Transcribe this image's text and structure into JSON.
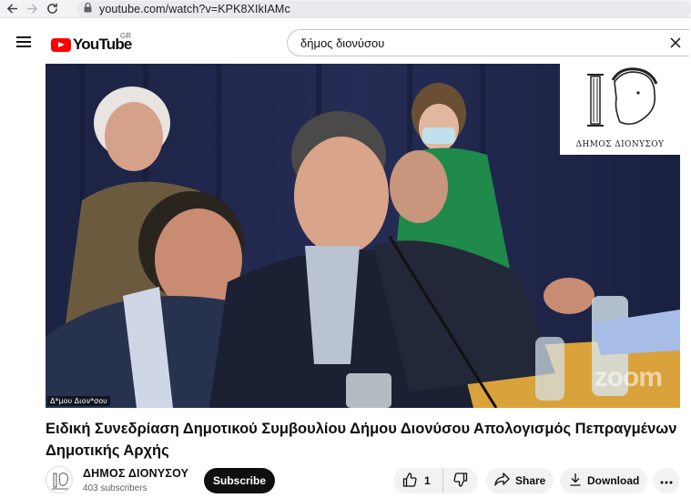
{
  "browser": {
    "url": "youtube.com/watch?v=KPK8XIkIAMc"
  },
  "header": {
    "logo_text": "YouTube",
    "region": "GR",
    "search_value": "δήμος διονύσου"
  },
  "video": {
    "corner_caption": "Δ*μου Διον*σου",
    "logo_text": "ΔΗΜΟΣ ΔΙΟΝΥΣΟΥ",
    "watermark": "zoom"
  },
  "title": "Ειδική Συνεδρίαση Δημοτικού Συμβουλίου Δήμου Διονύσου Απολογισμός Πεπραγμένων Δημοτικής Αρχής",
  "channel": {
    "name": "ΔΗΜΟΣ ΔΙΟΝΥΣΟΥ",
    "subscribers": "403 subscribers",
    "subscribe_label": "Subscribe"
  },
  "actions": {
    "like_count": "1",
    "share_label": "Share",
    "download_label": "Download"
  },
  "icons": [
    "back-arrow-icon",
    "forward-arrow-icon",
    "reload-icon",
    "lock-icon",
    "menu-icon",
    "clear-icon",
    "thumbs-up-icon",
    "thumbs-down-icon",
    "share-icon",
    "download-icon",
    "more-icon"
  ]
}
